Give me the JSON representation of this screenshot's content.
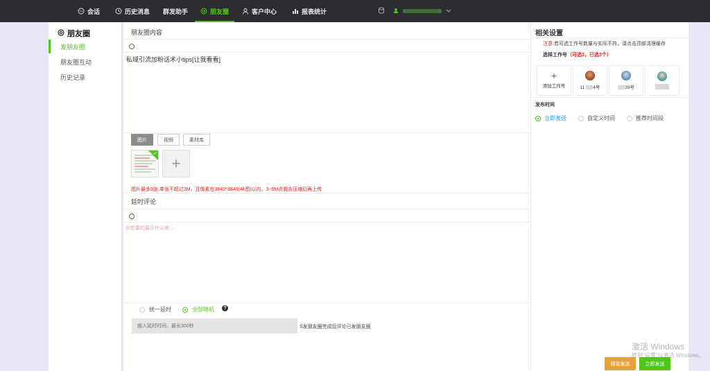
{
  "nav": {
    "items": [
      {
        "label": "会话",
        "icon": "chat-icon"
      },
      {
        "label": "历史消息",
        "icon": "clock-icon"
      },
      {
        "label": "群发助手",
        "icon": ""
      },
      {
        "label": "朋友圈",
        "icon": "moments-icon"
      },
      {
        "label": "客户中心",
        "icon": "user-icon"
      },
      {
        "label": "报表统计",
        "icon": "bar-chart-icon"
      }
    ],
    "active_index": 3,
    "accent": "#52c41a"
  },
  "sidebar": {
    "title": "朋友圈",
    "items": [
      {
        "label": "发朋友圈"
      },
      {
        "label": "朋友圈互动"
      },
      {
        "label": "历史记录"
      }
    ]
  },
  "main": {
    "content_title": "朋友圈内容",
    "content_text": "私域引流加粉话术小tips[让我看看]",
    "tabs": [
      "图片",
      "视频",
      "素材库"
    ],
    "warning": "图片最多9张,单张不超过3M，且像素在3840*3840(4k图)以内，3~5M点我去压缩后再上传",
    "comment_title": "延时评论",
    "comment_placeholder": "你想要的展示什么呢 ...",
    "delay_options": [
      "统一延时",
      "全部随机"
    ],
    "delay_input_placeholder": "输入延时时间，最长300秒",
    "delay_note": "S发朋友圈完成后评论已发朋友圈"
  },
  "right": {
    "title": "相关设置",
    "note_prefix": "注意:",
    "note_text": "若可选工作号数量与实际不符，请点击顶部清理缓存",
    "select_label": "选择工作号",
    "select_count": "（可选3，已选3个）",
    "add_account": "添加工作号",
    "accounts": [
      {
        "name_start": "11",
        "name_end": "4号"
      },
      {
        "name_start": "",
        "name_end": "35号"
      },
      {
        "name_start": "",
        "name_end": ""
      }
    ],
    "publish_time_label": "发布时间",
    "publish_options": [
      "立即发送",
      "自定义时间",
      "推荐时间段"
    ],
    "preview_button": "预览发送",
    "send_button": "立即发送"
  },
  "watermark": {
    "line1": "激活 Windows",
    "line2": "转到\"设置\"以激活 Windows。"
  }
}
